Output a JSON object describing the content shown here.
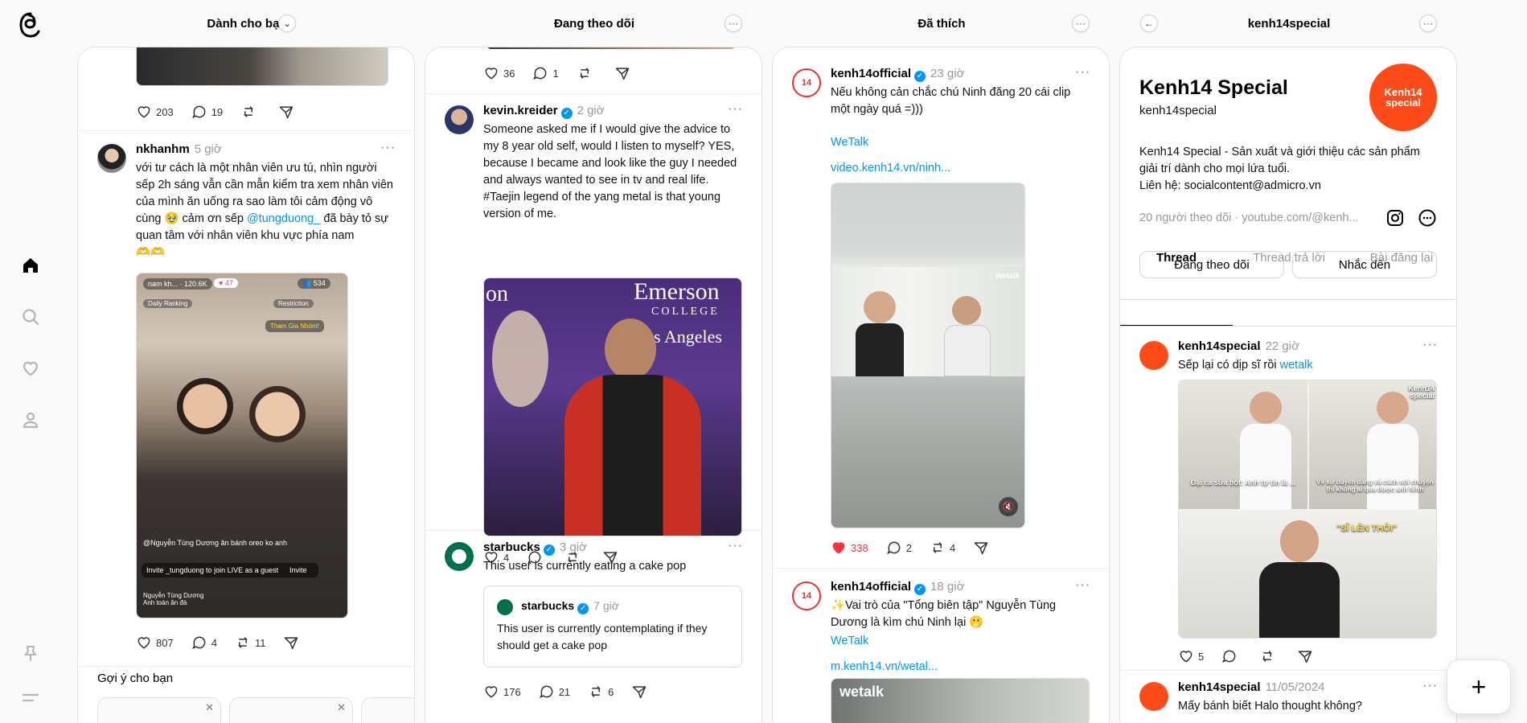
{
  "columns": [
    {
      "title": "Dành cho bạn",
      "button": "⌄"
    },
    {
      "title": "Đang theo dõi",
      "button": "···"
    },
    {
      "title": "Đã thích",
      "button": "···"
    },
    {
      "title": "kenh14special",
      "button": "···",
      "back": "←"
    }
  ],
  "col1": {
    "top_actions": {
      "likes": "203",
      "replies": "19"
    },
    "post": {
      "user": "nkhanhm",
      "time": "5 giờ",
      "text_a": "với tư cách là một nhân viên ưu tú, nhìn người sếp 2h sáng vẫn cần mẫn kiểm tra xem nhân viên của mình ăn uống ra sao làm tôi cảm động vô cùng 🥹 cảm ơn sếp ",
      "mention": "@tungduong_",
      "text_b": " đã bày tỏ sự quan tâm với nhân viên khu vực phía nam",
      "text_c": "🫶🫶",
      "likes": "807",
      "replies": "4",
      "reposts": "11",
      "overlay": {
        "host": "nam kh...",
        "host_sub": "120.6K",
        "hearts": "47",
        "viewers": "534",
        "daily": "Daily Ranking",
        "restriction": "Restriction",
        "banner": "Tham Gia Nhóm!",
        "comment": "@Nguyễn Tùng Dương ăn bánh oreo ko anh",
        "invite_text": "Invite _tungduong to join LIVE as a guest",
        "invite_btn": "Invite",
        "viewer_name": "Nguyễn Tùng Dương",
        "viewer_msg": "Anh toàn ăn đà"
      }
    },
    "suggest": "Gợi ý cho bạn"
  },
  "col2": {
    "top_actions": {
      "likes": "36",
      "replies": "1"
    },
    "post1": {
      "user": "kevin.kreider",
      "time": "2 giờ",
      "text": "Someone asked me if I would give the advice to my 8 year old self, would I listen to myself? YES, because I became and look like the guy I needed and always wanted to see in tv and real life. #Taejin legend of the yang metal is that young version of me.",
      "banner_a": "on",
      "banner_b": "Emerson",
      "banner_c": "COLLEGE",
      "banner_d": "os Angeles",
      "likes": "4"
    },
    "post2": {
      "user": "starbucks",
      "time": "3 giờ",
      "text": "This user is currently eating a cake pop",
      "quote_user": "starbucks",
      "quote_time": "7 giờ",
      "quote_text": "This user is currently contemplating if they should get a cake pop",
      "likes": "176",
      "replies": "21",
      "reposts": "6"
    }
  },
  "col3": {
    "post1": {
      "user": "kenh14official",
      "time": "23 giờ",
      "text": "Nếu không cản chắc chú Ninh đăng 20 cái clip một ngày quá =)))",
      "tag": "WeTalk",
      "url": "video.kenh14.vn/ninh...",
      "watermark": "wetalk",
      "likes": "338",
      "replies": "2",
      "reposts": "4"
    },
    "post2": {
      "user": "kenh14official",
      "time": "18 giờ",
      "text": "✨Vai trò của \"Tổng biên tập\" Nguyễn Tùng Dương là kìm chú Ninh lại 🫢",
      "tag": "WeTalk",
      "url": "m.kenh14.vn/wetal...",
      "thumb_text": "wetalk"
    }
  },
  "col4": {
    "name": "Kenh14 Special",
    "handle": "kenh14special",
    "logo_text": "Kenh14 special",
    "bio_a": "Kenh14 Special - Sản xuất và giới thiệu các sản phẩm giải trí dành cho mọi lứa tuổi.",
    "bio_b": "Liên hệ: socialcontent@admicro.vn",
    "followers": "20 người theo dõi · youtube.com/@kenh...",
    "btn_follow": "Đang theo dõi",
    "btn_mention": "Nhắc đến",
    "tabs": [
      "Thread",
      "Thread trả lời",
      "Bài đăng lại"
    ],
    "post1": {
      "user": "kenh14special",
      "time": "22 giờ",
      "text": "Sếp lại có dịp sĩ rồi ",
      "tag": "wetalk",
      "cap1": "Đại ca sữa bột: Anh tự tin là ...",
      "cap2": "Vẻ sự duyên dáng và cách nói chuyện thì không ai qua được anh Ninh",
      "cap3": "\"SĨ LÊN THÔI\"",
      "watermark": "Kenh14 special",
      "likes": "5"
    },
    "post2": {
      "user": "kenh14special",
      "time": "11/05/2024",
      "text": "Mấy bánh biết Halo thought không?"
    }
  },
  "fab": "+",
  "colors": {
    "accent": "#0095f6",
    "like_red": "#ff3040",
    "kenh14_orange": "#ff4a1a"
  }
}
